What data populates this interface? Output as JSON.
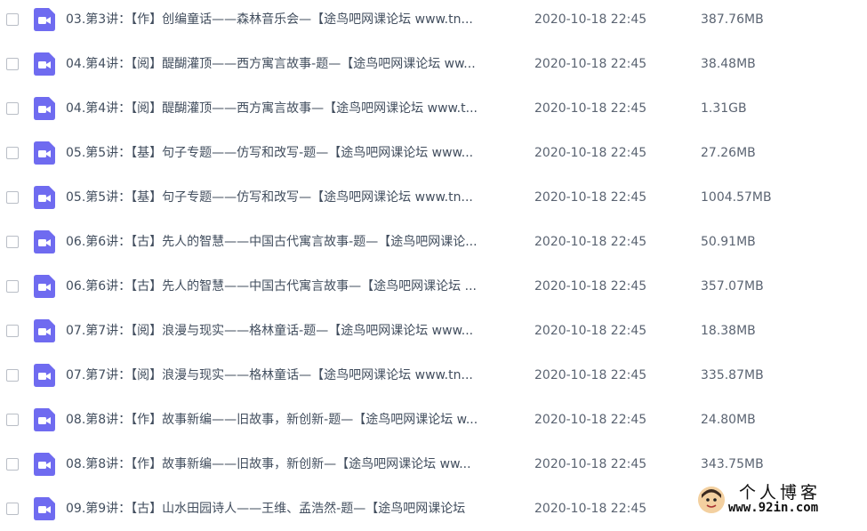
{
  "files": [
    {
      "name": "03.第3讲：【作】创编童话——森林音乐会—【途鸟吧网课论坛 www.tn...",
      "date": "2020-10-18 22:45",
      "size": "387.76MB"
    },
    {
      "name": "04.第4讲：【阅】醍醐灌顶——西方寓言故事-题—【途鸟吧网课论坛 ww...",
      "date": "2020-10-18 22:45",
      "size": "38.48MB"
    },
    {
      "name": "04.第4讲：【阅】醍醐灌顶——西方寓言故事—【途鸟吧网课论坛 www.t...",
      "date": "2020-10-18 22:45",
      "size": "1.31GB"
    },
    {
      "name": "05.第5讲：【基】句子专题——仿写和改写-题—【途鸟吧网课论坛 www...",
      "date": "2020-10-18 22:45",
      "size": "27.26MB"
    },
    {
      "name": "05.第5讲：【基】句子专题——仿写和改写—【途鸟吧网课论坛 www.tn...",
      "date": "2020-10-18 22:45",
      "size": "1004.57MB"
    },
    {
      "name": "06.第6讲：【古】先人的智慧——中国古代寓言故事-题—【途鸟吧网课论...",
      "date": "2020-10-18 22:45",
      "size": "50.91MB"
    },
    {
      "name": "06.第6讲：【古】先人的智慧——中国古代寓言故事—【途鸟吧网课论坛 ...",
      "date": "2020-10-18 22:45",
      "size": "357.07MB"
    },
    {
      "name": "07.第7讲：【阅】浪漫与现实——格林童话-题—【途鸟吧网课论坛 www...",
      "date": "2020-10-18 22:45",
      "size": "18.38MB"
    },
    {
      "name": "07.第7讲：【阅】浪漫与现实——格林童话—【途鸟吧网课论坛 www.tn...",
      "date": "2020-10-18 22:45",
      "size": "335.87MB"
    },
    {
      "name": "08.第8讲：【作】故事新编——旧故事，新创新-题—【途鸟吧网课论坛 w...",
      "date": "2020-10-18 22:45",
      "size": "24.80MB"
    },
    {
      "name": "08.第8讲：【作】故事新编——旧故事，新创新—【途鸟吧网课论坛 ww...",
      "date": "2020-10-18 22:45",
      "size": "343.75MB"
    },
    {
      "name": "09.第9讲：【古】山水田园诗人——王维、孟浩然-题—【途鸟吧网课论坛",
      "date": "2020-10-18 22:45",
      "size": ""
    }
  ],
  "watermark": {
    "title": "个人博客",
    "url": "www.92in.com"
  },
  "colors": {
    "file_icon": "#6f6bf0",
    "text": "#424e5e",
    "meta": "#5b6472",
    "checkbox_border": "#b9bec6"
  },
  "icons": {
    "file": "video-file-icon",
    "checkbox": "checkbox-icon"
  }
}
